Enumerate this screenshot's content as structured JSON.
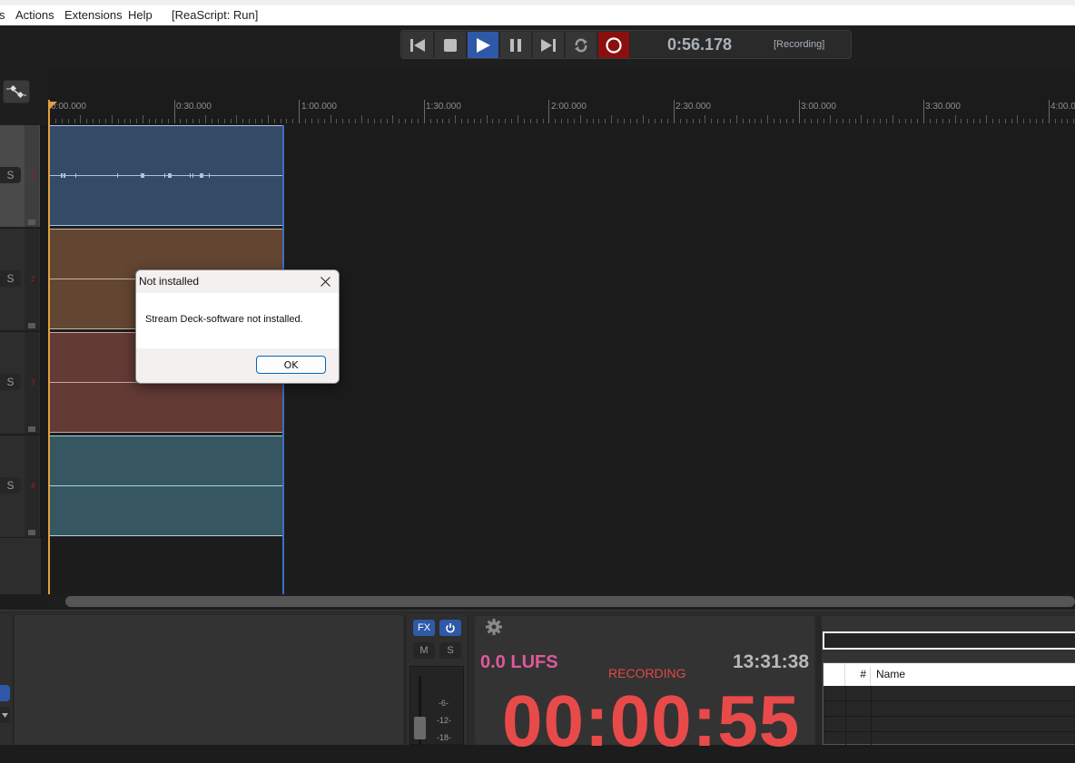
{
  "menu": {
    "items": [
      "s",
      "Actions",
      "Extensions",
      "Help"
    ],
    "script_status": "[ReaScript: Run]"
  },
  "transport": {
    "buttons": [
      {
        "name": "go-to-start",
        "icon": "skip-back-icon",
        "active": false
      },
      {
        "name": "stop",
        "icon": "stop-icon",
        "active": false
      },
      {
        "name": "play",
        "icon": "play-icon",
        "active": true
      },
      {
        "name": "pause",
        "icon": "pause-icon",
        "active": false
      },
      {
        "name": "go-to-end",
        "icon": "skip-forward-icon",
        "active": false
      },
      {
        "name": "repeat",
        "icon": "repeat-icon",
        "active": false
      },
      {
        "name": "record",
        "icon": "record-icon",
        "active": true
      }
    ],
    "position": "0:56.178",
    "status": "[Recording]",
    "colors": {
      "play_active": "#2f59a8",
      "record_active": "#8a1010"
    }
  },
  "ruler": {
    "labels": [
      "0:00.000",
      "0:30.000",
      "1:00.000",
      "1:30.000",
      "2:00.000",
      "2:30.000",
      "3:00.000",
      "3:30.000",
      "4:00.000"
    ]
  },
  "tracks": [
    {
      "number": "1",
      "solo_label": "S",
      "selected": true,
      "item_color": "#354a66",
      "item_border": "#a8c4e8"
    },
    {
      "number": "2",
      "solo_label": "S",
      "selected": false,
      "item_color": "#634631",
      "item_border": "#c7b6a5"
    },
    {
      "number": "3",
      "solo_label": "S",
      "selected": false,
      "item_color": "#643a35",
      "item_border": "#c9a9a2"
    },
    {
      "number": "4",
      "solo_label": "S",
      "selected": false,
      "item_color": "#365661",
      "item_border": "#a9d6e0"
    }
  ],
  "mixer": {
    "fx_label": "FX",
    "power_icon": "power-icon",
    "mute_label": "M",
    "solo_label": "S",
    "db_marks": [
      "-6-",
      "-12-",
      "-18-"
    ]
  },
  "recorder": {
    "loudness": "0.0 LUFS",
    "state": "RECORDING",
    "clock": "13:31:38",
    "elapsed": "00:00:55",
    "settings_icon": "gear-icon"
  },
  "list_panel": {
    "search_value": "",
    "columns": [
      "",
      "#",
      "Name"
    ],
    "rows": [
      [],
      [],
      [],
      []
    ]
  },
  "dialog": {
    "title": "Not installed",
    "message": "Stream Deck-software not installed.",
    "ok_label": "OK"
  }
}
